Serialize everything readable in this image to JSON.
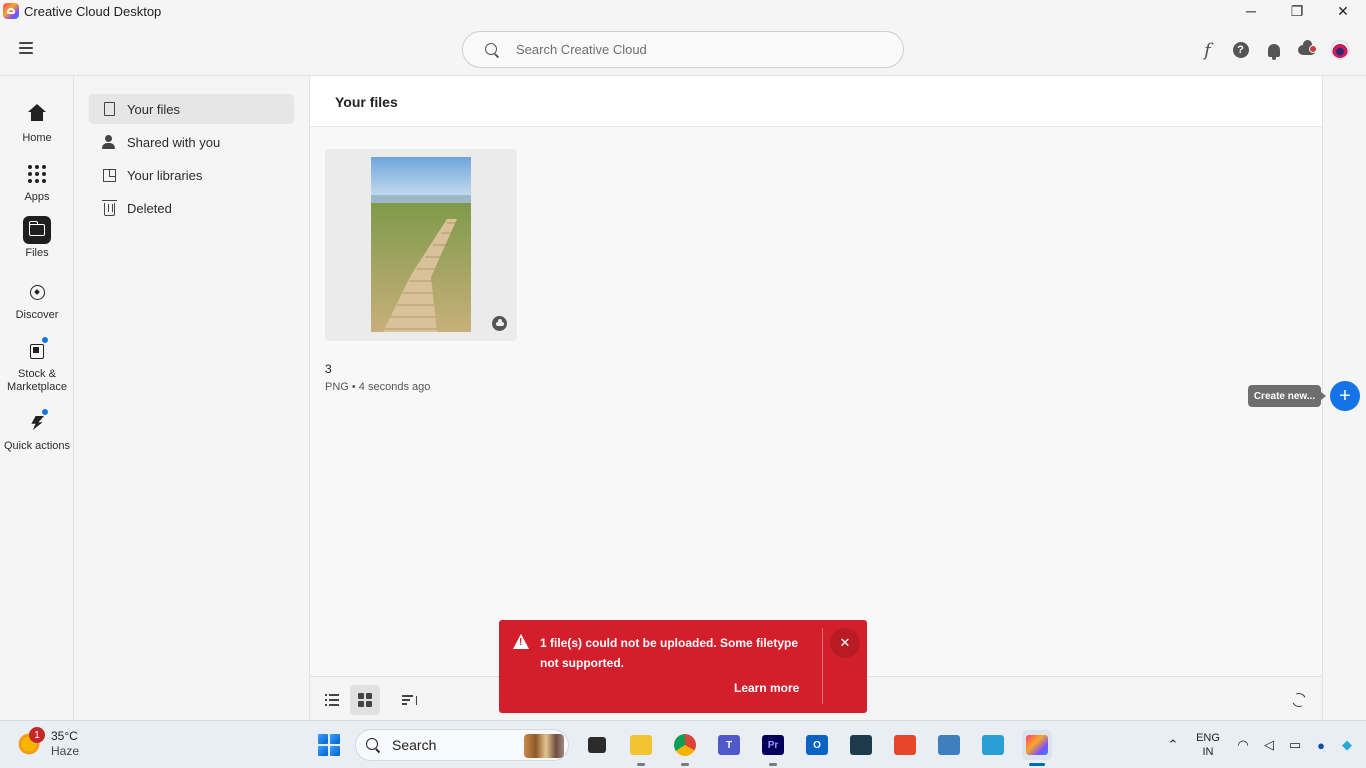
{
  "window": {
    "title": "Creative Cloud Desktop",
    "controls": {
      "minimize": "─",
      "maximize": "❐",
      "close": "✕"
    }
  },
  "header": {
    "search_placeholder": "Search Creative Cloud",
    "icons": [
      "fonts-icon",
      "help-icon",
      "bell-icon",
      "cloud-sync-icon",
      "avatar"
    ],
    "font_glyph": "f",
    "help_glyph": "?"
  },
  "rail": {
    "items": [
      {
        "label": "Home",
        "icon": "home-icon"
      },
      {
        "label": "Apps",
        "icon": "apps-grid-icon"
      },
      {
        "label": "Files",
        "icon": "folder-icon",
        "active": true
      },
      {
        "label": "Discover",
        "icon": "compass-icon"
      },
      {
        "label": "Stock & Marketplace",
        "icon": "stock-icon"
      },
      {
        "label": "Quick actions",
        "icon": "quick-actions-icon"
      }
    ]
  },
  "sidebar": {
    "items": [
      {
        "label": "Your files",
        "icon": "document-icon",
        "active": true
      },
      {
        "label": "Shared with you",
        "icon": "users-icon"
      },
      {
        "label": "Your libraries",
        "icon": "libraries-icon"
      },
      {
        "label": "Deleted",
        "icon": "trash-icon"
      }
    ]
  },
  "main": {
    "title": "Your files",
    "files": [
      {
        "name": "3",
        "meta": "PNG • 4 seconds ago",
        "thumbnail": "boardwalk beach path",
        "status_icon": "cloud-icon"
      }
    ]
  },
  "fab": {
    "label": "+",
    "tooltip": "Create new..."
  },
  "toast": {
    "message": "1 file(s) could not be uploaded. Some filetype not supported.",
    "action": "Learn more",
    "close": "✕",
    "color": "#d31f2b"
  },
  "taskbar": {
    "weather": {
      "temp": "35°C",
      "condition": "Haze",
      "badge": "1"
    },
    "search_label": "Search",
    "apps": [
      {
        "name": "file-explorer-dark",
        "glyph": ""
      },
      {
        "name": "file-explorer",
        "glyph": ""
      },
      {
        "name": "chrome",
        "glyph": ""
      },
      {
        "name": "teams",
        "glyph": "T"
      },
      {
        "name": "premiere-pro",
        "glyph": "Pr"
      },
      {
        "name": "outlook",
        "glyph": "O"
      },
      {
        "name": "app-sketch",
        "glyph": ""
      },
      {
        "name": "app-red",
        "glyph": ""
      },
      {
        "name": "app-grid",
        "glyph": ""
      },
      {
        "name": "app-monitor",
        "glyph": ""
      },
      {
        "name": "creative-cloud",
        "glyph": ""
      }
    ],
    "language": {
      "line1": "ENG",
      "line2": "IN"
    }
  },
  "colors": {
    "accent": "#1473e6",
    "toast_bg": "#d31f2b",
    "rail_active": "#1f1f1f"
  }
}
